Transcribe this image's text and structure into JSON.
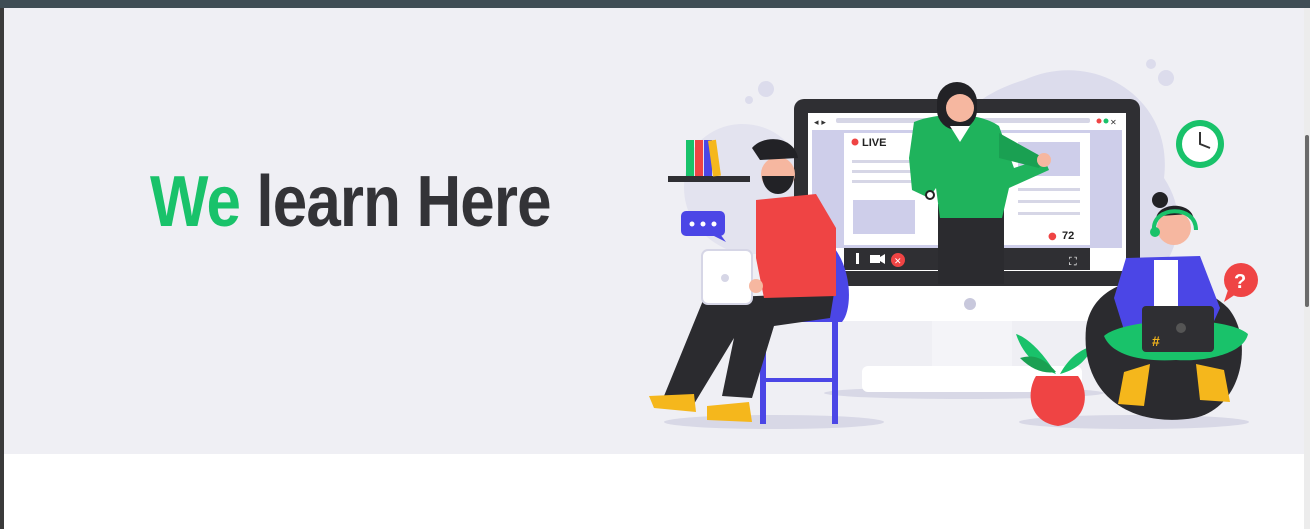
{
  "hero": {
    "title_accent": "We",
    "title_rest": "learn Here"
  },
  "illustration": {
    "live_label": "LIVE",
    "viewer_count": "72",
    "hashtag": "#",
    "question_mark": "?"
  },
  "colors": {
    "accent": "#19c26a",
    "text_dark": "#333337",
    "hero_bg": "#efeff4",
    "topbar": "#3f4d55"
  }
}
